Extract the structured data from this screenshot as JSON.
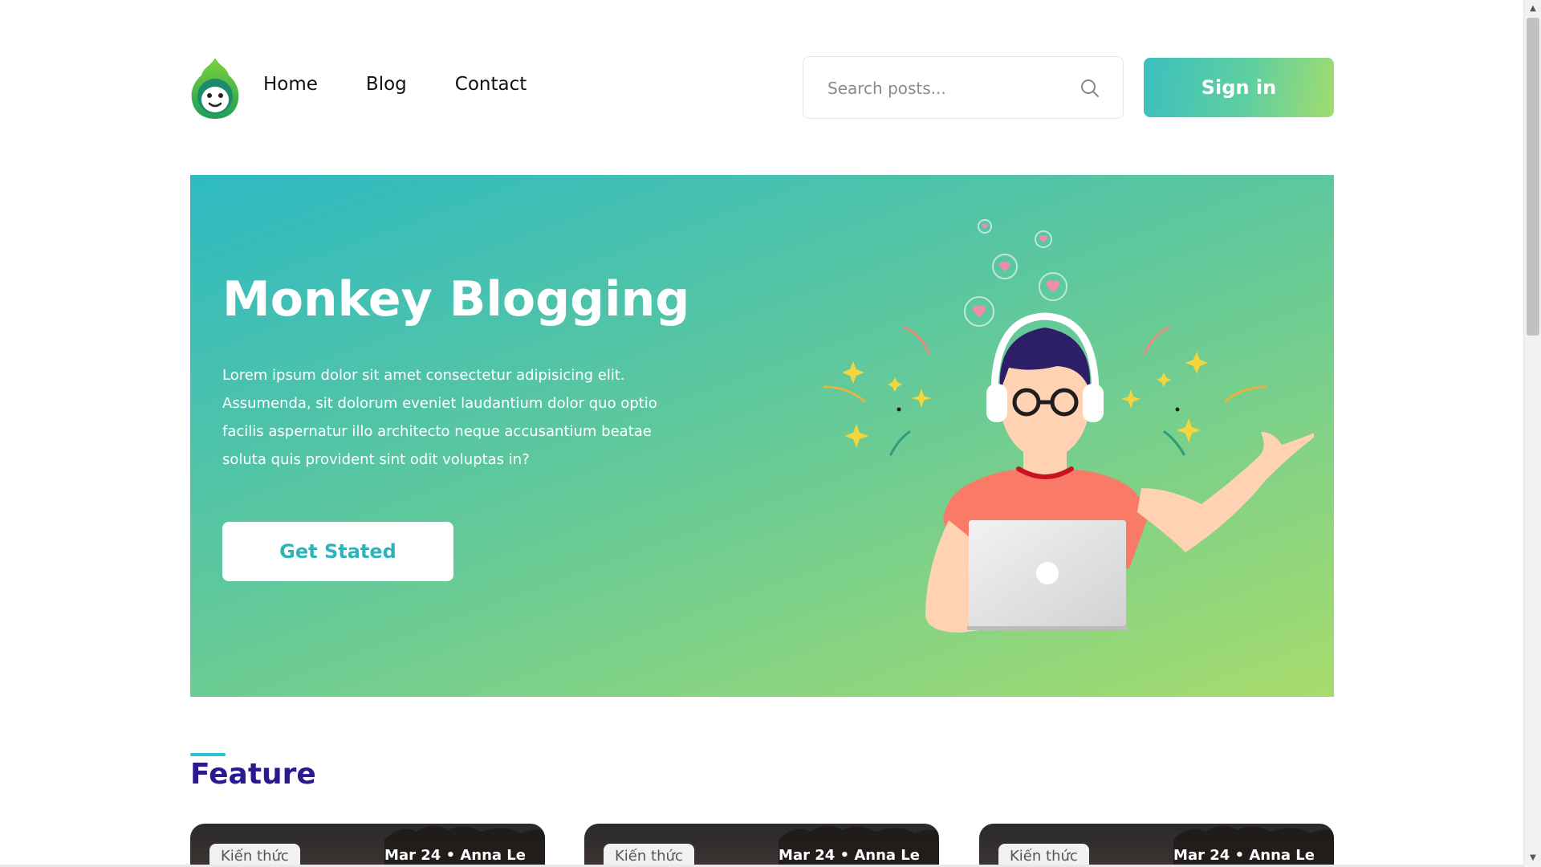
{
  "header": {
    "logo_name": "monkey-logo",
    "nav": [
      {
        "label": "Home"
      },
      {
        "label": "Blog"
      },
      {
        "label": "Contact"
      }
    ],
    "search": {
      "placeholder": "Search posts...",
      "value": ""
    },
    "signin_label": "Sign in"
  },
  "hero": {
    "title": "Monkey Blogging",
    "description": "Lorem ipsum dolor sit amet consectetur adipisicing elit. Assumenda, sit dolorum eveniet laudantium dolor quo optio facilis aspernatur illo architecto neque accusantium beatae soluta quis provident sint odit voluptas in?",
    "cta_label": "Get Stated"
  },
  "feature": {
    "title": "Feature",
    "cards": [
      {
        "category": "Kiến thức",
        "meta": "Mar 24 • Anna Le"
      },
      {
        "category": "Kiến thức",
        "meta": "Mar 24 • Anna Le"
      },
      {
        "category": "Kiến thức",
        "meta": "Mar 24 • Anna Le"
      }
    ]
  },
  "colors": {
    "accent_start": "#2eb9c3",
    "accent_end": "#a7dc6d",
    "feature_title": "#2a1a8f",
    "feature_bar": "#22c7d6"
  },
  "icons": {
    "search": "search-icon",
    "scroll_up": "scroll-up-arrow-icon",
    "scroll_down": "scroll-down-arrow-icon"
  }
}
